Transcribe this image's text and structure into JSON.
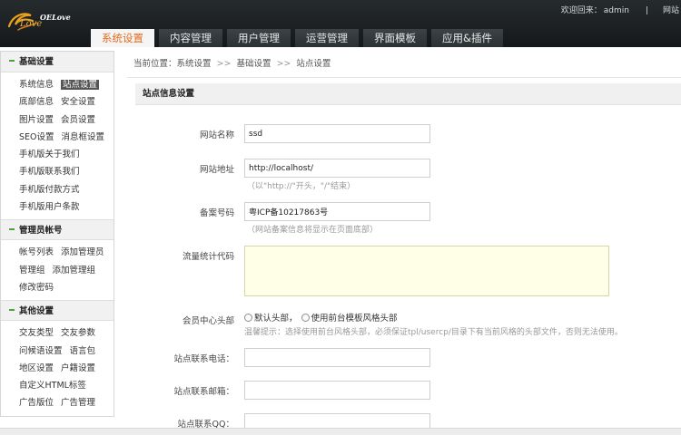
{
  "header": {
    "logo_text": "OELove",
    "welcome_label": "欢迎回来：",
    "username": "admin",
    "separator": "|",
    "right_link": "网站"
  },
  "nav_tabs": [
    {
      "label": "系统设置",
      "active": true
    },
    {
      "label": "内容管理",
      "active": false
    },
    {
      "label": "用户管理",
      "active": false
    },
    {
      "label": "运营管理",
      "active": false
    },
    {
      "label": "界面模板",
      "active": false
    },
    {
      "label": "应用&插件",
      "active": false
    }
  ],
  "sidebar": {
    "groups": [
      {
        "title": "基础设置",
        "rows": [
          [
            "系统信息",
            "站点设置"
          ],
          [
            "底部信息",
            "安全设置"
          ],
          [
            "图片设置",
            "会员设置"
          ],
          [
            "SEO设置",
            "消息框设置"
          ],
          [
            "手机版关于我们"
          ],
          [
            "手机版联系我们"
          ],
          [
            "手机版付款方式"
          ],
          [
            "手机版用户条款"
          ]
        ]
      },
      {
        "title": "管理员帐号",
        "rows": [
          [
            "帐号列表",
            "添加管理员"
          ],
          [
            "管理组",
            "添加管理组"
          ],
          [
            "修改密码"
          ]
        ]
      },
      {
        "title": "其他设置",
        "rows": [
          [
            "交友类型",
            "交友参数"
          ],
          [
            "问候语设置",
            "语言包"
          ],
          [
            "地区设置",
            "户籍设置"
          ],
          [
            "自定义HTML标签"
          ],
          [
            "广告版位",
            "广告管理"
          ]
        ]
      }
    ],
    "active_item": "站点设置"
  },
  "breadcrumb": {
    "prefix": "当前位置：",
    "items": [
      "系统设置",
      "基础设置",
      "站点设置"
    ],
    "separator": ">>"
  },
  "section_title": "站点信息设置",
  "form": {
    "site_name_label": "网站名称",
    "site_name_value": "ssd",
    "site_url_label": "网站地址",
    "site_url_value": "http://localhost/",
    "site_url_hint": "（以\"http://\"开头，\"/\"结束）",
    "icp_label": "备案号码",
    "icp_value": "粤ICP备10217863号",
    "icp_hint": "（网站备案信息将显示在页面底部）",
    "stats_label": "流量统计代码",
    "stats_value": "",
    "member_header_label": "会员中心头部",
    "member_header_options": [
      "默认头部，",
      "使用前台模板风格头部"
    ],
    "member_header_tip": "温馨提示：选择使用前台风格头部，必须保证tpl/usercp/目录下有当前风格的头部文件，否则无法使用。",
    "phone_label": "站点联系电话：",
    "phone_value": "",
    "email_label": "站点联系邮箱：",
    "email_value": "",
    "qq_label": "站点联系QQ：",
    "qq_value": ""
  },
  "colors": {
    "header_bg": "#1b1f22",
    "active_tab_text": "#e36b1c",
    "group_marker": "#48a537",
    "textarea_bg": "#ffffe8"
  }
}
